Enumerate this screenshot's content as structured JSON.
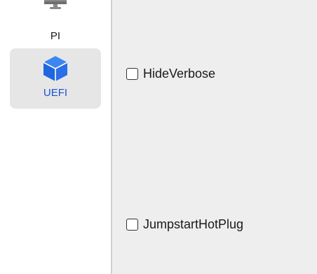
{
  "sidebar": {
    "items": [
      {
        "label": "PI",
        "icon": "monitor-icon",
        "selected": false
      },
      {
        "label": "UEFI",
        "icon": "cube-icon",
        "selected": true
      }
    ]
  },
  "options": [
    {
      "label": "HideVerbose",
      "checked": false
    },
    {
      "label": "JumpstartHotPlug",
      "checked": false
    }
  ],
  "colors": {
    "accent": "#1a53d6",
    "selected_bg": "#e6e6e6",
    "content_bg": "#eeeeee"
  }
}
